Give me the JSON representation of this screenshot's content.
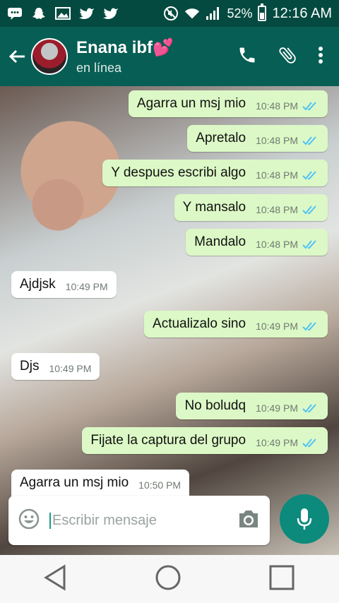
{
  "status": {
    "battery": "52%",
    "time": "12:16 AM",
    "icons": [
      "message-icon",
      "snapchat-icon",
      "gallery-icon",
      "twitter-icon",
      "twitter-icon",
      "no-sound-icon",
      "wifi-icon",
      "signal-icon"
    ]
  },
  "header": {
    "name": "Enana ibf💕",
    "status": "en línea",
    "actions": [
      "phone-icon",
      "attach-icon",
      "menu-icon"
    ]
  },
  "messages": [
    {
      "dir": "out",
      "text": "Agarra un msj mio",
      "time": "10:48 PM"
    },
    {
      "dir": "out",
      "text": "Apretalo",
      "time": "10:48 PM"
    },
    {
      "dir": "out",
      "text": "Y despues escribi algo",
      "time": "10:48 PM"
    },
    {
      "dir": "out",
      "text": "Y mansalo",
      "time": "10:48 PM"
    },
    {
      "dir": "out",
      "text": "Mandalo",
      "time": "10:48 PM"
    },
    {
      "dir": "in",
      "text": "Ajdjsk",
      "time": "10:49 PM"
    },
    {
      "dir": "out",
      "text": "Actualizalo sino",
      "time": "10:49 PM"
    },
    {
      "dir": "in",
      "text": "Djs",
      "time": "10:49 PM"
    },
    {
      "dir": "out",
      "text": "No boludq",
      "time": "10:49 PM"
    },
    {
      "dir": "out",
      "text": "Fijate la captura del grupo",
      "time": "10:49 PM"
    },
    {
      "dir": "in",
      "text": "Agarra un msj mio",
      "time": "10:50 PM"
    }
  ],
  "composer": {
    "placeholder": "Escribir mensaje",
    "emoji_icon": "emoji-icon",
    "camera_icon": "camera-icon",
    "mic_icon": "mic-icon"
  },
  "nav": [
    "back-icon",
    "home-icon",
    "recents-icon"
  ],
  "colors": {
    "appbar": "#075e54",
    "statusbar": "#044a40",
    "outgoing": "#dcf8c6",
    "incoming": "#ffffff",
    "ticks": "#4fc3f7",
    "mic": "#0c8a7c"
  }
}
